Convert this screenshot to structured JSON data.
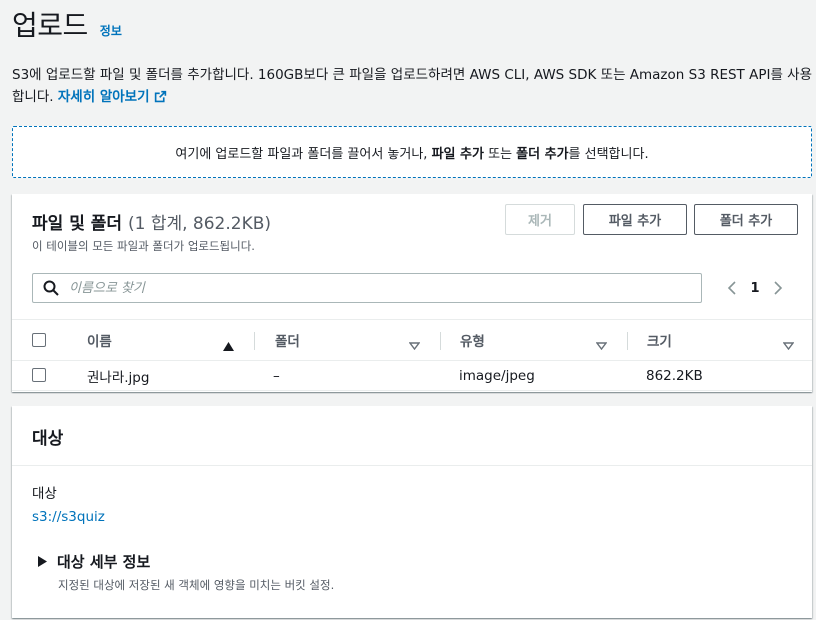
{
  "header": {
    "title": "업로드",
    "info": "정보"
  },
  "description": {
    "text": "S3에 업로드할 파일 및 폴더를 추가합니다. 160GB보다 큰 파일을 업로드하려면 AWS CLI, AWS SDK 또는 Amazon S3 REST API를 사용합니다.",
    "link": "자세히 알아보기"
  },
  "dropzone": {
    "prefix": "여기에 업로드할 파일과 폴더를 끌어서 놓거나,",
    "add_files": "파일 추가",
    "mid": "또는",
    "add_folder": "폴더 추가",
    "suffix": "를 선택합니다."
  },
  "files": {
    "title": "파일 및 폴더",
    "count": "(1 합계, 862.2KB)",
    "subtitle": "이 테이블의 모든 파일과 폴더가 업로드됩니다.",
    "buttons": {
      "remove": "제거",
      "add_file": "파일 추가",
      "add_folder": "폴더 추가"
    },
    "search_placeholder": "이름으로 찾기",
    "page": "1",
    "columns": [
      "이름",
      "폴더",
      "유형",
      "크기"
    ],
    "rows": [
      {
        "name": "권나라.jpg",
        "folder": "–",
        "type": "image/jpeg",
        "size": "862.2KB"
      }
    ]
  },
  "target": {
    "title": "대상",
    "label": "대상",
    "bucket": "s3://s3quiz",
    "details_title": "대상 세부 정보",
    "details_desc": "지정된 대상에 저장된 새 객체에 영향을 미치는 버킷 설정."
  },
  "colors": {
    "link": "#0073bb",
    "text": "#16191f",
    "muted": "#545b64",
    "background": "#f2f3f3"
  },
  "icons": {
    "external": "external-link-icon",
    "search": "search-icon",
    "prev": "chevron-left-icon",
    "next": "chevron-right-icon",
    "sort_asc": "sort-ascending-icon",
    "sort": "sort-caret-icon",
    "expand": "caret-right-icon"
  }
}
